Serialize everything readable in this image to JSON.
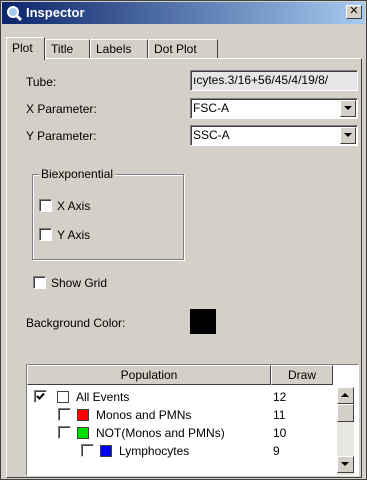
{
  "window": {
    "title": "Inspector",
    "close_symbol": "✕",
    "icon": "magnifier-icon"
  },
  "tabs": [
    {
      "label": "Plot",
      "active": true
    },
    {
      "label": "Title",
      "active": false
    },
    {
      "label": "Labels",
      "active": false
    },
    {
      "label": "Dot Plot",
      "active": false
    }
  ],
  "plot": {
    "tube_label": "Tube:",
    "tube_value": "ıcytes.3/16+56/45/4/19/8/",
    "x_param_label": "X Parameter:",
    "x_param_value": "FSC-A",
    "y_param_label": "Y Parameter:",
    "y_param_value": "SSC-A",
    "biexponential": {
      "legend": "Biexponential",
      "x_axis_label": "X Axis",
      "x_axis_checked": false,
      "y_axis_label": "Y Axis",
      "y_axis_checked": false
    },
    "show_grid_label": "Show Grid",
    "show_grid_checked": false,
    "background_color_label": "Background Color:",
    "background_color": "#000000"
  },
  "population_table": {
    "columns": [
      "Population",
      "Draw"
    ],
    "rows": [
      {
        "name": "All Events",
        "draw": "12",
        "checked": true,
        "color": "#ffffff"
      },
      {
        "name": "Monos and PMNs",
        "draw": "11",
        "checked": false,
        "color": "#ff0000"
      },
      {
        "name": "NOT(Monos and PMNs)",
        "draw": "10",
        "checked": false,
        "color": "#00dd00"
      },
      {
        "name": "Lymphocytes",
        "draw": "9",
        "checked": false,
        "color": "#0000ff"
      }
    ]
  }
}
